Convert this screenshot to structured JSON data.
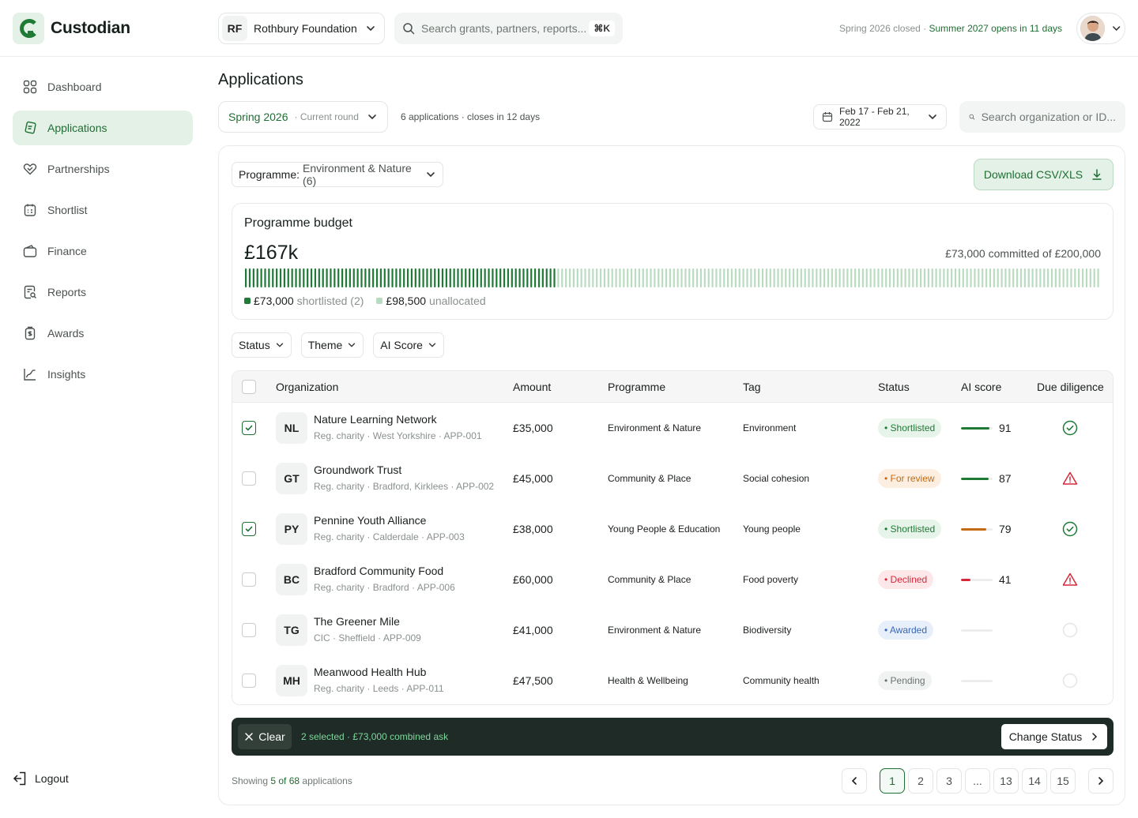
{
  "app": {
    "brand": "Custodian"
  },
  "header": {
    "org_initials": "RF",
    "org_name": "Rothbury Foundation",
    "search_placeholder": "Search grants, partners, reports...",
    "search_shortcut": "⌘K",
    "round_closed": "Spring 2026 closed · ",
    "round_opens": "Summer 2027 opens in 11 days"
  },
  "sidebar": {
    "items": [
      {
        "label": "Dashboard",
        "icon": "dashboard-icon"
      },
      {
        "label": "Applications",
        "icon": "applications-icon"
      },
      {
        "label": "Partnerships",
        "icon": "handshake-icon"
      },
      {
        "label": "Shortlist",
        "icon": "shortlist-icon"
      },
      {
        "label": "Finance",
        "icon": "wallet-icon"
      },
      {
        "label": "Reports",
        "icon": "reports-icon"
      },
      {
        "label": "Awards",
        "icon": "award-icon"
      },
      {
        "label": "Insights",
        "icon": "insights-icon"
      }
    ],
    "active_index": 1,
    "logout": "Logout"
  },
  "page": {
    "title": "Applications",
    "round_name": "Spring 2026",
    "round_caption": "· Current round",
    "apps_info": "6 applications · closes in 12 days",
    "date_range": "Feb 17 - Feb 21, 2022",
    "org_search_placeholder": "Search organization or ID..."
  },
  "programme_filter": {
    "label": "Programme:",
    "value": "Environment & Nature (6)"
  },
  "download_label": "Download CSV/XLS",
  "budget": {
    "title": "Programme budget",
    "amount": "£167k",
    "committed_text": "£73,000 committed of £200,000",
    "committed_fraction": 0.365,
    "shortlisted_amount": "£73,000",
    "shortlisted_label": "shortlisted (2)",
    "unallocated_amount": "£98,500",
    "unallocated_label": "unallocated",
    "colors": {
      "committed": "#1f7a36",
      "remaining": "#b9dcc1"
    }
  },
  "filters": [
    "Status",
    "Theme",
    "AI Score"
  ],
  "table": {
    "columns": [
      "Organization",
      "Amount",
      "Programme",
      "Tag",
      "Status",
      "AI score",
      "Due diligence"
    ],
    "rows": [
      {
        "initials": "NL",
        "name": "Nature Learning Network",
        "sub": "Reg. charity · West Yorkshire · APP-001",
        "amount": "£35,000",
        "programme": "Environment & Nature",
        "tag": "Environment",
        "status": "• Shortlisted",
        "status_kind": "shortlisted",
        "ai": "91",
        "ai_value": 91,
        "ai_color": "#1f7a36",
        "dd": "ok",
        "checked": true
      },
      {
        "initials": "GT",
        "name": "Groundwork Trust",
        "sub": "Reg. charity · Bradford, Kirklees · APP-002",
        "amount": "£45,000",
        "programme": "Community & Place",
        "tag": "Social cohesion",
        "status": "• For review",
        "status_kind": "review",
        "ai": "87",
        "ai_value": 87,
        "ai_color": "#1f7a36",
        "dd": "warn",
        "checked": false
      },
      {
        "initials": "PY",
        "name": "Pennine Youth Alliance",
        "sub": "Reg. charity · Calderdale · APP-003",
        "amount": "£38,000",
        "programme": "Young People & Education",
        "tag": "Young people",
        "status": "• Shortlisted",
        "status_kind": "shortlisted",
        "ai": "79",
        "ai_value": 79,
        "ai_color": "#c46a12",
        "dd": "ok",
        "checked": true
      },
      {
        "initials": "BC",
        "name": "Bradford Community Food",
        "sub": "Reg. charity · Bradford · APP-006",
        "amount": "£60,000",
        "programme": "Community & Place",
        "tag": "Food poverty",
        "status": "• Declined",
        "status_kind": "declined",
        "ai": "41",
        "ai_value": 30,
        "ai_color": "#d6283a",
        "dd": "warn",
        "checked": false
      },
      {
        "initials": "TG",
        "name": "The Greener Mile",
        "sub": "CIC · Sheffield · APP-009",
        "amount": "£41,000",
        "programme": "Environment & Nature",
        "tag": "Biodiversity",
        "status": "• Awarded",
        "status_kind": "awarded",
        "ai": "",
        "ai_value": 0,
        "ai_color": "#1f7a36",
        "dd": "none",
        "checked": false
      },
      {
        "initials": "MH",
        "name": "Meanwood Health Hub",
        "sub": "Reg. charity · Leeds · APP-011",
        "amount": "£47,500",
        "programme": "Health & Wellbeing",
        "tag": "Community health",
        "status": "• Pending",
        "status_kind": "pending",
        "ai": "",
        "ai_value": 0,
        "ai_color": "#1f7a36",
        "dd": "none",
        "checked": false
      }
    ]
  },
  "status_styles": {
    "shortlisted": {
      "bg": "#e6f4e9",
      "fg": "#1f7a36"
    },
    "review": {
      "bg": "#fcefe2",
      "fg": "#c46a12"
    },
    "declined": {
      "bg": "#fde7e8",
      "fg": "#d6283a"
    },
    "awarded": {
      "bg": "#e7effb",
      "fg": "#3a66b5"
    },
    "pending": {
      "bg": "#f1f3f2",
      "fg": "#6c7470"
    }
  },
  "actionbar": {
    "clear": "Clear",
    "selection": "2 selected · £73,000 combined ask",
    "change_status": "Change Status"
  },
  "footer": {
    "showing_prefix": "Showing ",
    "showing_count": "5 of 68",
    "showing_suffix": " applications",
    "pages": [
      "1",
      "2",
      "3",
      "...",
      "13",
      "14",
      "15"
    ],
    "current_page": "1"
  }
}
